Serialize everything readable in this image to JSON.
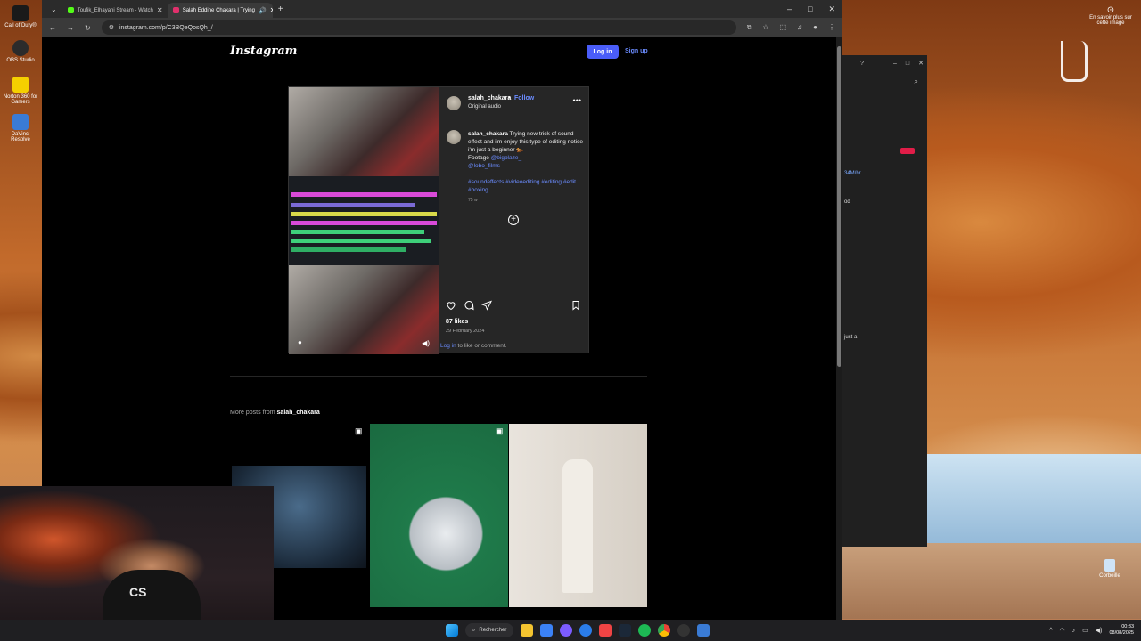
{
  "desktop": {
    "icons_left": [
      {
        "label": "Call of Duty®",
        "color": "#1a1a1a"
      },
      {
        "label": "OBS Studio",
        "color": "#2b2b2b"
      },
      {
        "label": "Norton 360 for Gamers",
        "color": "#f5d000"
      },
      {
        "label": "DaVinci Resolve",
        "color": "#3a7bd5"
      }
    ],
    "topright_label": "En savoir plus sur cette image",
    "recycle_bin_label": "Corbeille"
  },
  "browser": {
    "tabs": [
      {
        "title": "Toufik_Elhayani Stream - Watch",
        "fav_color": "#53fc18",
        "active": false
      },
      {
        "title": "Salah Eddine Chakara | Trying",
        "fav_color": "#e1306c",
        "active": true
      }
    ],
    "new_tab": "+",
    "url": "instagram.com/p/C3BQeQosQh_/"
  },
  "instagram": {
    "logo": "Instagram",
    "login_label": "Log in",
    "signup_label": "Sign up",
    "post": {
      "username": "salah_chakara",
      "dot": "•",
      "follow_label": "Follow",
      "audio": "Original audio",
      "caption_user": "salah_chakara",
      "caption_text": "Trying new trick of sound effect and i'm enjoy this type of editing notice i'm just a beginner 🐅",
      "footage_label": "Footage",
      "mentions": [
        "@bigblaze_",
        "@lobo_films"
      ],
      "hashtags": "#soundeffects #videoediting #editing #edit #boxing",
      "caption_time": "75 w",
      "likes": "87 likes",
      "date": "29 February 2024",
      "login_link": "Log in",
      "comment_suffix": "to like or comment."
    },
    "more_posts_prefix": "More posts from",
    "more_posts_user": "salah_chakara"
  },
  "sidewin": {
    "items": [
      "34M/hr",
      "od",
      "just a"
    ]
  },
  "taskbar": {
    "search_label": "Rechercher",
    "time": "00:33",
    "date": "08/08/2025"
  }
}
